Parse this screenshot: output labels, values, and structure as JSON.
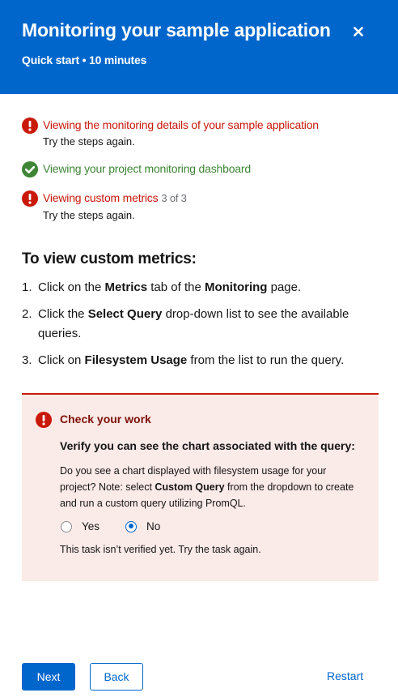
{
  "header": {
    "title": "Monitoring your sample application",
    "subtitle": "Quick start • 10 minutes",
    "close_icon": "close-icon"
  },
  "tasks": [
    {
      "status": "failed",
      "icon": "exclamation-circle-icon",
      "title": "Viewing the monitoring details of your sample application",
      "note": "Try the steps again."
    },
    {
      "status": "success",
      "icon": "check-circle-icon",
      "title": "Viewing your project monitoring dashboard"
    },
    {
      "status": "failed",
      "icon": "exclamation-circle-icon",
      "title": "Viewing custom metrics",
      "count": "3 of 3",
      "note": "Try the steps again."
    }
  ],
  "instructions": {
    "title": "To view custom metrics:",
    "steps": [
      {
        "num": "1.",
        "pre": "Click on the ",
        "b1": "Metrics",
        "mid": " tab of the ",
        "b2": "Monitoring",
        "post": " page."
      },
      {
        "num": "2.",
        "pre": "Click the ",
        "b1": "Select Query",
        "post": " drop-down list to see the available queries."
      },
      {
        "num": "3.",
        "pre": "Click on ",
        "b1": "Filesystem Usage",
        "post": " from the list to run the query."
      }
    ]
  },
  "check_work": {
    "title": "Check your work",
    "question": "Verify you can see the chart associated with the query:",
    "desc_pre": "Do you see a chart displayed with filesystem usage for your project? Note: select ",
    "desc_bold": "Custom Query",
    "desc_post": " from the dropdown to create and run a custom query utilizing PromQL.",
    "yes_label": "Yes",
    "no_label": "No",
    "selected": "No",
    "status": "This task isn’t verified yet. Try the task again."
  },
  "footer": {
    "next_label": "Next",
    "back_label": "Back",
    "restart_label": "Restart"
  },
  "colors": {
    "primary": "#0066cc",
    "danger": "#c9190b",
    "success": "#3e8635",
    "alert_bg": "#faeae8"
  }
}
